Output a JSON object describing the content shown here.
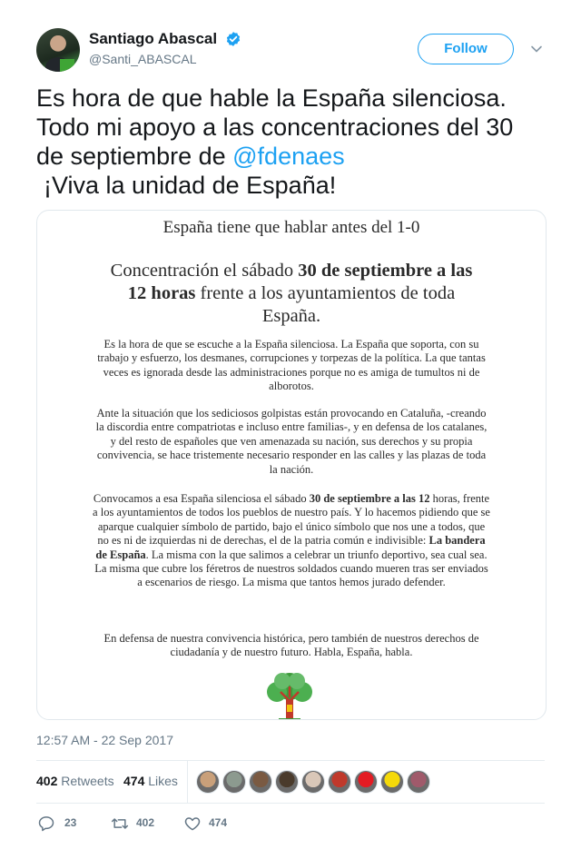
{
  "author": {
    "name": "Santiago Abascal",
    "handle": "@Santi_ABASCAL",
    "verified": true
  },
  "header": {
    "follow_label": "Follow",
    "menu_icon": "chevron-down-icon"
  },
  "tweet": {
    "text_line1": "Es hora de que hable la España silenciosa.",
    "text_line2": "Todo mi apoyo a las concentraciones del 30",
    "text_line3_prefix": "de septiembre de ",
    "mention": "@fdenaes",
    "text_line4": "¡Viva la unidad de España!"
  },
  "image_doc": {
    "title": "España tiene que hablar antes del 1-0",
    "headline_a": "Concentración el sábado ",
    "headline_b": "30 de septiembre a las 12 horas",
    "headline_c": " frente a los ayuntamientos de toda España.",
    "p1": "Es la hora de que se escuche a la España silenciosa. La España que soporta, con su trabajo y esfuerzo, los desmanes, corrupciones y torpezas de la política. La que tantas veces es ignorada desde las administraciones porque no es amiga de tumultos ni de alborotos.",
    "p2": "Ante la situación que los sediciosos golpistas están provocando en Cataluña, -creando la discordia entre compatriotas e incluso entre familias-, y en defensa de los catalanes, y del resto de españoles que ven amenazada su nación, sus derechos y su propia convivencia, se hace tristemente necesario responder en las calles y las plazas de toda la nación.",
    "p3_a": "Convocamos a esa España silenciosa el sábado ",
    "p3_b": "30 de septiembre a las 12",
    "p3_c": " horas, frente a los ayuntamientos de todos los pueblos de nuestro país. Y lo hacemos pidiendo que se aparque cualquier símbolo de partido, bajo el único símbolo que nos une a todos, que no es ni de izquierdas ni de derechas, el de la patria común e indivisible: ",
    "p3_d": "La bandera de España",
    "p3_e": ". La misma con la que salimos a celebrar un triunfo deportivo, sea cual sea. La misma que cubre los féretros de nuestros soldados cuando mueren tras ser enviados a escenarios de riesgo. La misma que tantos hemos jurado defender.",
    "p4": "En defensa de nuestra convivencia histórica, pero también de nuestros derechos de ciudadanía y de nuestro futuro. Habla, España, habla."
  },
  "meta": {
    "timestamp": "12:57 AM - 22 Sep 2017"
  },
  "stats": {
    "retweets_count": "402",
    "retweets_label": "Retweets",
    "likes_count": "474",
    "likes_label": "Likes"
  },
  "likers": [
    {
      "name": "liker-avatar-1",
      "color": "#c9a07a"
    },
    {
      "name": "liker-avatar-2",
      "color": "#8c9a8f"
    },
    {
      "name": "liker-avatar-3",
      "color": "#7a5a42"
    },
    {
      "name": "liker-avatar-4",
      "color": "#4a3b2c"
    },
    {
      "name": "liker-avatar-5",
      "color": "#d9c7b8"
    },
    {
      "name": "liker-avatar-6",
      "color": "#c0392b"
    },
    {
      "name": "liker-avatar-7",
      "color": "#e31b23"
    },
    {
      "name": "liker-avatar-8",
      "color": "#f5d90a"
    },
    {
      "name": "liker-avatar-9",
      "color": "#a05a6b"
    }
  ],
  "actions": {
    "reply_count": "23",
    "retweet_count": "402",
    "like_count": "474"
  },
  "colors": {
    "accent": "#1da1f2",
    "text": "#14171a",
    "muted": "#657786",
    "border": "#e6ecf0"
  }
}
